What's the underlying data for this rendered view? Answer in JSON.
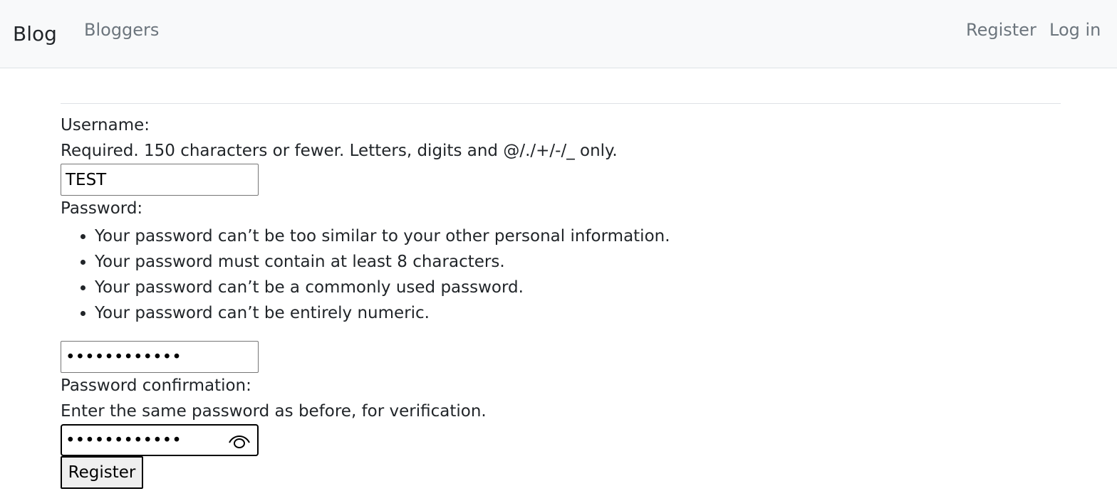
{
  "navbar": {
    "brand": "Blog",
    "links": [
      "Bloggers"
    ],
    "right_links": [
      "Register",
      "Log in"
    ]
  },
  "form": {
    "username": {
      "label": "Username:",
      "help": "Required. 150 characters or fewer. Letters, digits and @/./+/-/_ only.",
      "value": "TEST"
    },
    "password": {
      "label": "Password:",
      "help_items": [
        "Your password can’t be too similar to your other personal information.",
        "Your password must contain at least 8 characters.",
        "Your password can’t be a commonly used password.",
        "Your password can’t be entirely numeric."
      ],
      "masked_value": "••••••••••••"
    },
    "password_confirmation": {
      "label": "Password confirmation:",
      "help": "Enter the same password as before, for verification.",
      "masked_value": "••••••••••••",
      "reveal_icon": "eye-icon"
    },
    "submit_label": "Register"
  }
}
